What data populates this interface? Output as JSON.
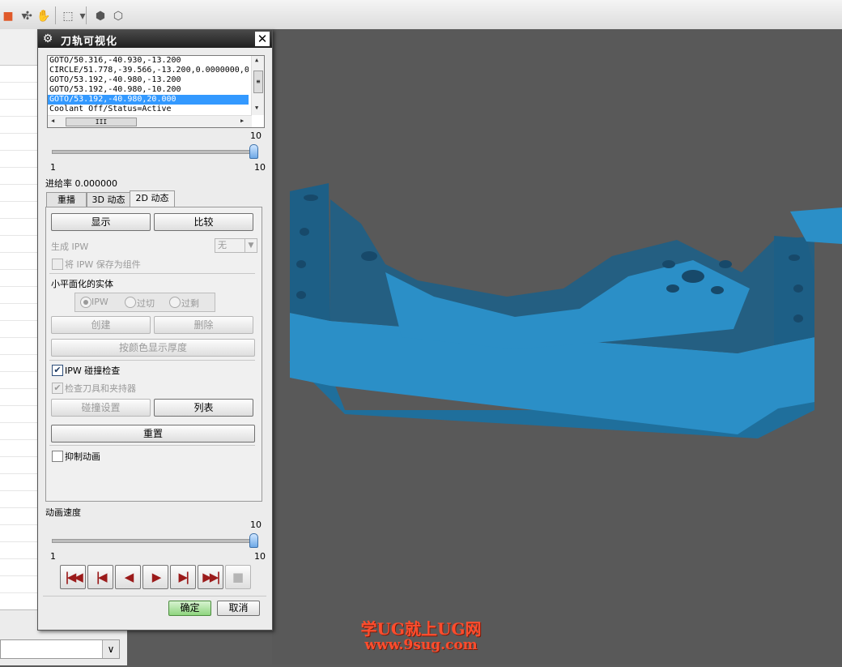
{
  "dialog": {
    "title": "刀轨可视化",
    "listbox_lines": [
      "GOTO/50.316,-40.930,-13.200",
      "CIRCLE/51.778,-39.566,-13.200,0.0000000,0",
      "GOTO/53.192,-40.980,-13.200",
      "GOTO/53.192,-40.980,-10.200",
      "GOTO/53.192,-40.980,20.000",
      "Coolant Off/Status=Active"
    ],
    "selected_line_index": 4,
    "scroll_thumb_mark": "III",
    "speed_slider": {
      "max_label": "10",
      "min_label": "1",
      "right_label": "10",
      "level": 10
    },
    "feed_rate_label": "进给率 0.000000",
    "tabs": [
      "重播",
      "3D 动态",
      "2D 动态"
    ],
    "active_tab": "2D 动态",
    "display_button": "显示",
    "compare_button": "比较",
    "generate_ipw_label": "生成 IPW",
    "generate_ipw_value": "无",
    "save_ipw_label": "将 IPW 保存为组件",
    "facet_section_title": "小平面化的实体",
    "radio_options": [
      "IPW",
      "过切",
      "过剩"
    ],
    "create_button": "创建",
    "delete_button": "删除",
    "color_thickness_button": "按颜色显示厚度",
    "ipw_collision_label": "IPW 碰撞检查",
    "check_tool_label": "检查刀具和夹持器",
    "collision_settings_button": "碰撞设置",
    "list_button": "列表",
    "reset_button": "重置",
    "suppress_animation_label": "抑制动画",
    "animation_speed_label": "动画速度",
    "anim_slider": {
      "max_label": "10",
      "min_label": "1",
      "right_label": "10",
      "level": 10
    },
    "ok_button": "确定",
    "cancel_button": "取消"
  },
  "watermark": {
    "line1": "学UG就上UG网",
    "line2": "www.9sug.com"
  },
  "colors": {
    "part": "#2b8fc7",
    "part_dark": "#1f6f9c",
    "viewport": "#595959",
    "title_bar": "#2a2a2a",
    "selection": "#3399ff",
    "watermark": "#ff4d2d"
  }
}
